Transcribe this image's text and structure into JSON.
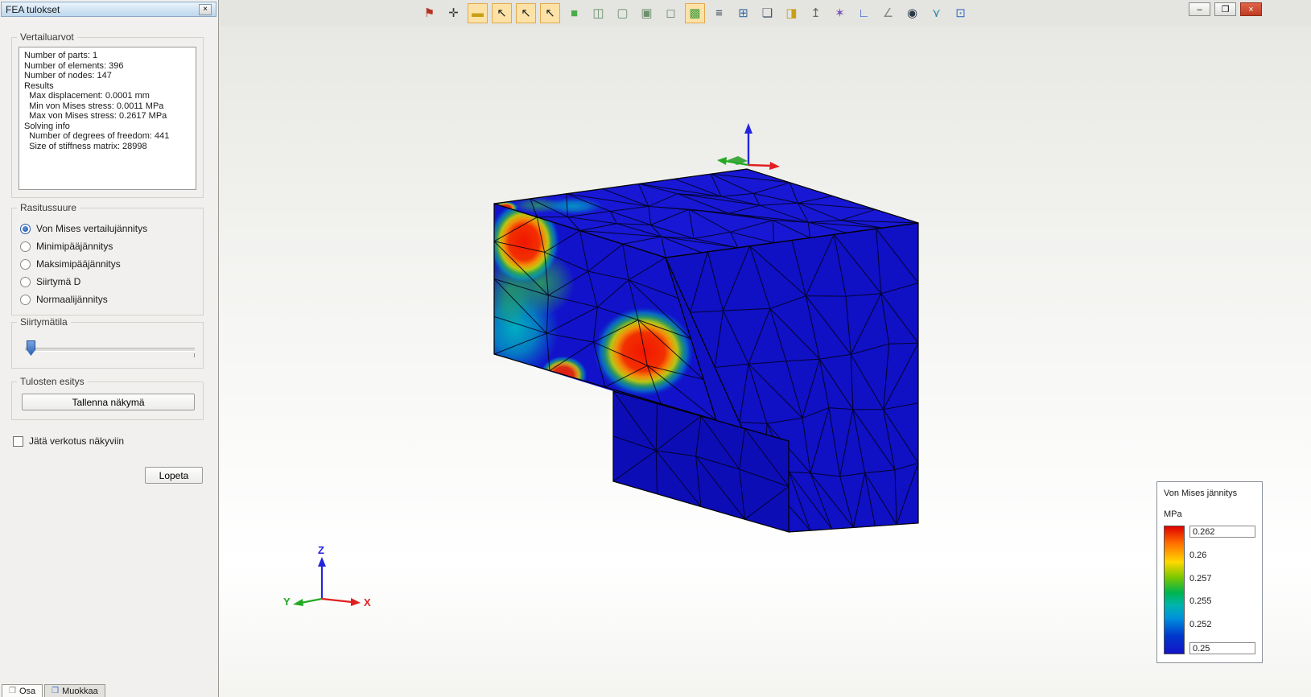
{
  "dialog": {
    "title": "FEA tulokset",
    "close_glyph": "×",
    "groups": {
      "summary": {
        "label": "Vertailuarvot",
        "lines": [
          "Number of parts: 1",
          "Number of elements: 396",
          "Number of nodes: 147",
          "Results",
          "  Max displacement: 0.0001 mm",
          "  Min von Mises stress: 0.0011 MPa",
          "  Max von Mises stress: 0.2617 MPa",
          "Solving info",
          "  Number of degrees of freedom: 441",
          "  Size of stiffness matrix: 28998"
        ]
      },
      "quantity": {
        "label": "Rasitussuure",
        "options": [
          {
            "label": "Von Mises vertailujännitys",
            "selected": true
          },
          {
            "label": "Minimipääjännitys",
            "selected": false
          },
          {
            "label": "Maksimipääjännitys",
            "selected": false
          },
          {
            "label": "Siirtymä D",
            "selected": false
          },
          {
            "label": "Normaalijännitys",
            "selected": false
          }
        ]
      },
      "displacement": {
        "label": "Siirtymätila"
      },
      "presentation": {
        "label": "Tulosten esitys",
        "button": "Tallenna näkymä"
      }
    },
    "mesh_checkbox_label": "Jätä verkotus näkyviin",
    "close_button": "Lopeta"
  },
  "toolbar": {
    "icons": [
      {
        "name": "pin-icon",
        "glyph": "⚑",
        "color": "#b43522",
        "active": false
      },
      {
        "name": "fit-view-icon",
        "glyph": "✛",
        "color": "#3a3a3a",
        "active": false
      },
      {
        "name": "ruler-icon",
        "glyph": "▬",
        "color": "#c8a018",
        "active": true
      },
      {
        "name": "select-vertex-icon",
        "glyph": "↖",
        "color": "#222222",
        "active": true
      },
      {
        "name": "select-edge-icon",
        "glyph": "↖",
        "color": "#222222",
        "active": true
      },
      {
        "name": "select-face-icon",
        "glyph": "↖",
        "color": "#222222",
        "active": true
      },
      {
        "name": "solid-view-icon",
        "glyph": "■",
        "color": "#49ad49",
        "active": false
      },
      {
        "name": "box-transparent-icon",
        "glyph": "◫",
        "color": "#6d8f6d",
        "active": false
      },
      {
        "name": "box-hidden-lines-icon",
        "glyph": "▢",
        "color": "#6d8f6d",
        "active": false
      },
      {
        "name": "box-wireframe-icon",
        "glyph": "▣",
        "color": "#6d8f6d",
        "active": false
      },
      {
        "name": "box-shaded-icon",
        "glyph": "◻",
        "color": "#6d8f6d",
        "active": false
      },
      {
        "name": "mesh-view-icon",
        "glyph": "▩",
        "color": "#3f9e3f",
        "active": true
      },
      {
        "name": "report-icon",
        "glyph": "≡",
        "color": "#3a4a5a",
        "active": false
      },
      {
        "name": "sheets-icon",
        "glyph": "⊞",
        "color": "#3a6aa0",
        "active": false
      },
      {
        "name": "document-icon",
        "glyph": "❏",
        "color": "#4a5a6a",
        "active": false
      },
      {
        "name": "layers-box-icon",
        "glyph": "◨",
        "color": "#c8a018",
        "active": false
      },
      {
        "name": "export-icon",
        "glyph": "↥",
        "color": "#6a6a58",
        "active": false
      },
      {
        "name": "magic-wand-icon",
        "glyph": "✶",
        "color": "#7a55bb",
        "active": false
      },
      {
        "name": "axes-icon",
        "glyph": "∟",
        "color": "#3355cc",
        "active": false
      },
      {
        "name": "measure-angle-icon",
        "glyph": "∠",
        "color": "#888888",
        "active": false
      },
      {
        "name": "visibility-icon",
        "glyph": "◉",
        "color": "#2a3a4a",
        "active": false
      },
      {
        "name": "filter-icon",
        "glyph": "⋎",
        "color": "#2a88aa",
        "active": false
      },
      {
        "name": "external-window-icon",
        "glyph": "⊡",
        "color": "#3a6ec8",
        "active": false
      }
    ]
  },
  "window": {
    "minimize_glyph": "–",
    "maximize_glyph": "❐",
    "close_glyph": "×"
  },
  "viewport": {
    "triad": {
      "x": "X",
      "y": "Y",
      "z": "Z"
    },
    "colors": {
      "axis_x": "#e02020",
      "axis_y": "#22aa22",
      "axis_z": "#2424e0",
      "model_base": "#1111c4"
    }
  },
  "legend": {
    "title": "Von Mises jännitys",
    "unit": "MPa",
    "max": "0.262",
    "ticks": [
      "0.26",
      "0.257",
      "0.255",
      "0.252"
    ],
    "min": "0.25"
  },
  "tabs": [
    {
      "label": "Osa",
      "glyph": "❒",
      "color": "#8a8a82"
    },
    {
      "label": "Muokkaa",
      "glyph": "❒",
      "color": "#3a6ec8"
    }
  ]
}
